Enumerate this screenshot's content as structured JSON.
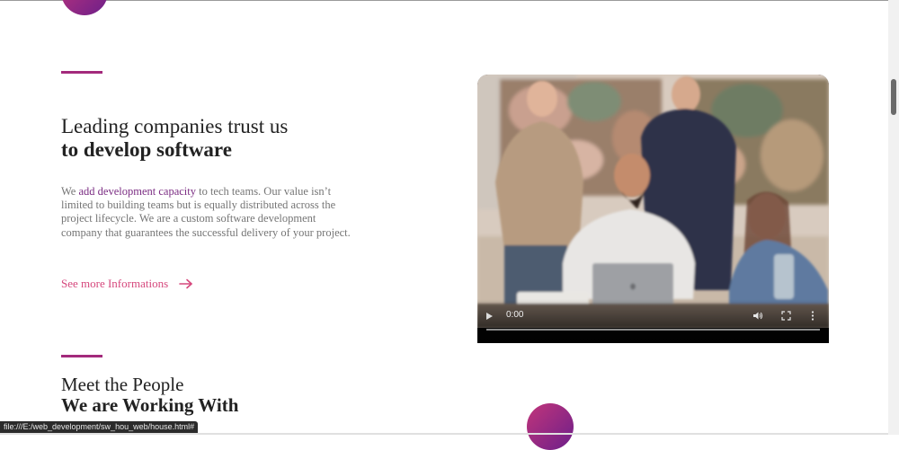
{
  "section1": {
    "heading_light": "Leading companies trust us",
    "heading_bold": "to develop software",
    "body_prefix": "We ",
    "body_highlight": "add development capacity",
    "body_rest": " to tech teams. Our value isn’t limited to building teams but is equally distributed across the project lifecycle. We are a custom software development company that guarantees the successful delivery of your project.",
    "link_label": "See more Informations",
    "link_icon": "arrow-right-icon"
  },
  "video": {
    "time": "0:00",
    "progress": 0,
    "play_icon": "play-icon",
    "volume_icon": "volume-icon",
    "fullscreen_icon": "fullscreen-icon",
    "more_icon": "more-vertical-icon"
  },
  "section2": {
    "heading_light": "Meet the People",
    "heading_bold": "We are Working With"
  },
  "status_bar": {
    "url": "file:///E:/web_development/sw_hou_web/house.html#"
  },
  "colors": {
    "accent_purple": "#a32a7c",
    "link_pink": "#d6487d",
    "highlight_text": "#7b2d83",
    "gradient_start": "#c2357a",
    "gradient_end": "#6c1f8a"
  }
}
